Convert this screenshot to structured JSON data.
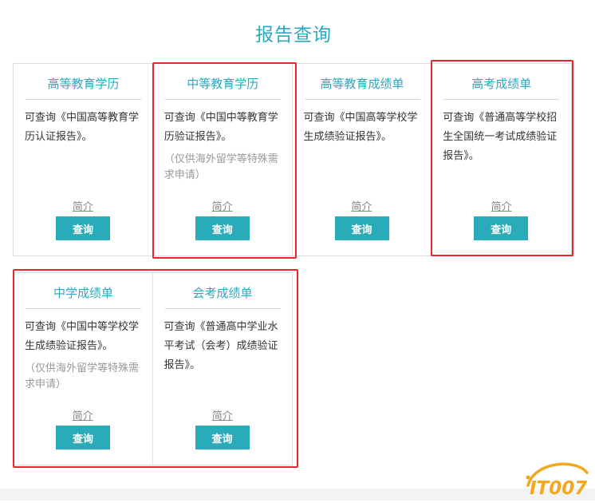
{
  "page": {
    "title": "报告查询"
  },
  "cards": [
    {
      "title": "高等教育学历",
      "desc": "可查询《中国高等教育学历认证报告》。",
      "note": "",
      "intro": "简介",
      "button": "查询"
    },
    {
      "title": "中等教育学历",
      "desc": "可查询《中国中等教育学历验证报告》。",
      "note": "（仅供海外留学等特殊需求申请）",
      "intro": "简介",
      "button": "查询"
    },
    {
      "title": "高等教育成绩单",
      "desc": "可查询《中国高等学校学生成绩验证报告》。",
      "note": "",
      "intro": "简介",
      "button": "查询"
    },
    {
      "title": "高考成绩单",
      "desc": "可查询《普通高等学校招生全国统一考试成绩验证报告》。",
      "note": "",
      "intro": "简介",
      "button": "查询"
    },
    {
      "title": "中学成绩单",
      "desc": "可查询《中国中等学校学生成绩验证报告》。",
      "note": "（仅供海外留学等特殊需求申请）",
      "intro": "简介",
      "button": "查询"
    },
    {
      "title": "会考成绩单",
      "desc": "可查询《普通高中学业水平考试（会考）成绩验证报告》。",
      "note": "",
      "intro": "简介",
      "button": "查询"
    }
  ],
  "watermark": {
    "text": "IT007"
  },
  "colors": {
    "accent": "#2aa9c0",
    "button": "#2aabb9",
    "highlight": "#e8262b"
  }
}
